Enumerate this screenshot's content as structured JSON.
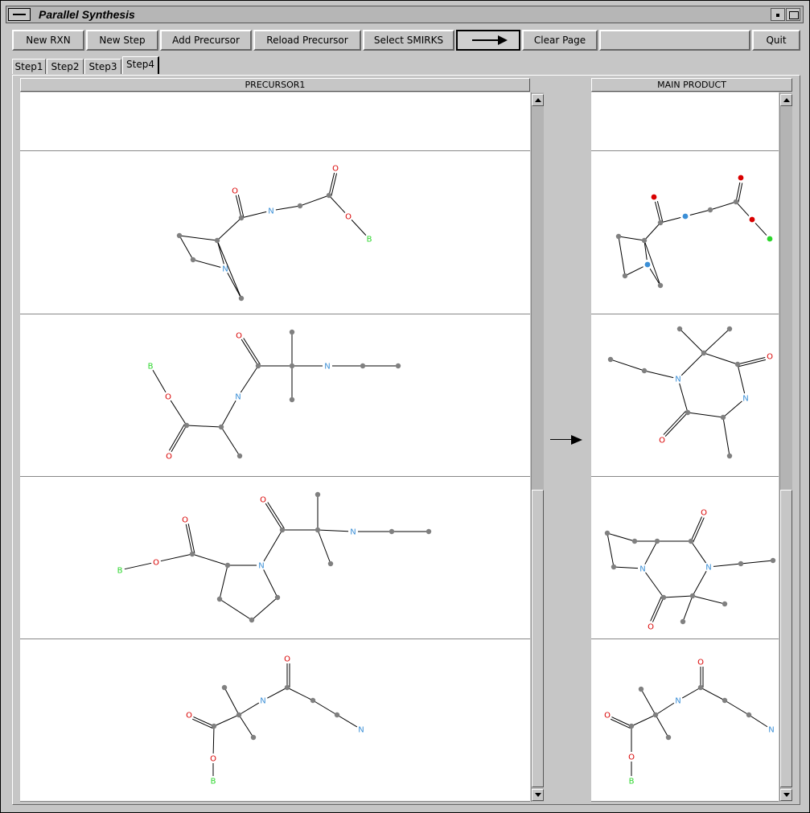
{
  "window": {
    "title": "Parallel Synthesis"
  },
  "toolbar": {
    "new_rxn": "New RXN",
    "new_step": "New Step",
    "add_precursor": "Add Precursor",
    "reload_precursor": "Reload Precursor",
    "select_smirks": "Select SMIRKS",
    "clear_page": "Clear Page",
    "quit": "Quit"
  },
  "tabs": [
    "Step1",
    "Step2",
    "Step3",
    "Step4"
  ],
  "active_tab": "Step4",
  "columns": {
    "left": "PRECURSOR1",
    "right": "MAIN PRODUCT"
  },
  "colors": {
    "N": "#3b8fd6",
    "O": "#d90000",
    "B": "#2bd62b",
    "C": "#808080",
    "bond": "#000000"
  },
  "icons": {
    "window_menu": "window-menu-icon",
    "arrow": "arrow-right-icon",
    "minimize": "minimize-icon",
    "maximize": "maximize-icon"
  },
  "labels": {
    "N": "N",
    "O": "O",
    "B": "B"
  }
}
